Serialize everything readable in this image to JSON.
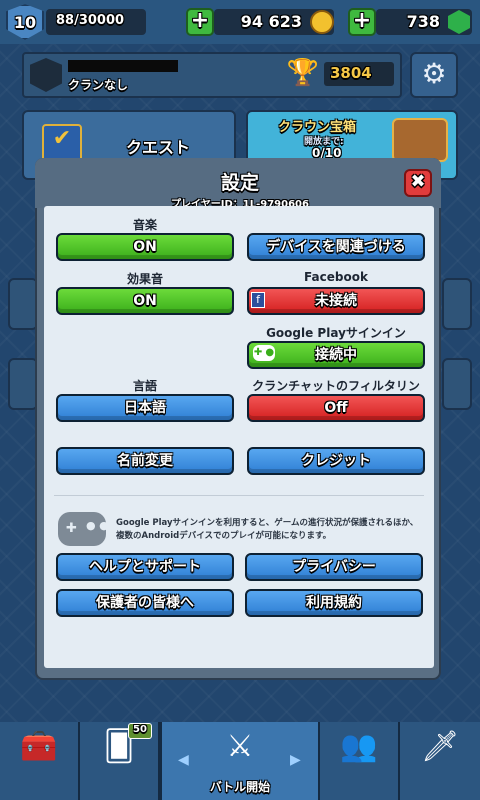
{
  "top_bar": {
    "level": "10",
    "xp": "88/30000",
    "gold": "94 623",
    "gems": "738",
    "plus_symbol": "+"
  },
  "profile": {
    "clan_name": "クランなし",
    "trophies": "3804",
    "gear_icon": "gear-icon"
  },
  "background": {
    "quest_label": "クエスト",
    "crown_chest_title": "クラウン宝箱",
    "crown_chest_sub": "開放まで:",
    "crown_chest_progress": "0/10"
  },
  "settings": {
    "title": "設定",
    "player_id": "プレイヤーID：1L-9790606",
    "close_symbol": "✖",
    "music_label": "音楽",
    "music_value": "ON",
    "sfx_label": "効果音",
    "sfx_value": "ON",
    "link_device": "デバイスを関連づける",
    "facebook_label": "Facebook",
    "facebook_status": "未接続",
    "facebook_icon": "f",
    "google_play_label": "Google Playサインイン",
    "google_play_status": "接続中",
    "language_label": "言語",
    "language_value": "日本語",
    "clan_chat_filter_label": "クランチャットのフィルタリング",
    "clan_chat_filter_value": "Off",
    "rename": "名前変更",
    "credits": "クレジット",
    "google_play_note": "Google Playサインインを利用すると、ゲームの進行状況が保護されるほか、複数のAndroidデバイスでのプレイが可能になります。",
    "help_support": "ヘルプとサポート",
    "privacy": "プライバシー",
    "parents": "保護者の皆様へ",
    "terms": "利用規約"
  },
  "bottom_nav": {
    "battle_label": "バトル開始",
    "cards_badge": "50",
    "arrow_left": "◀",
    "arrow_right": "▶"
  },
  "colors": {
    "button_blue": "#3a8ee0",
    "button_green": "#4cc226",
    "button_red": "#e23131",
    "panel_bg": "#e4ecf3"
  }
}
